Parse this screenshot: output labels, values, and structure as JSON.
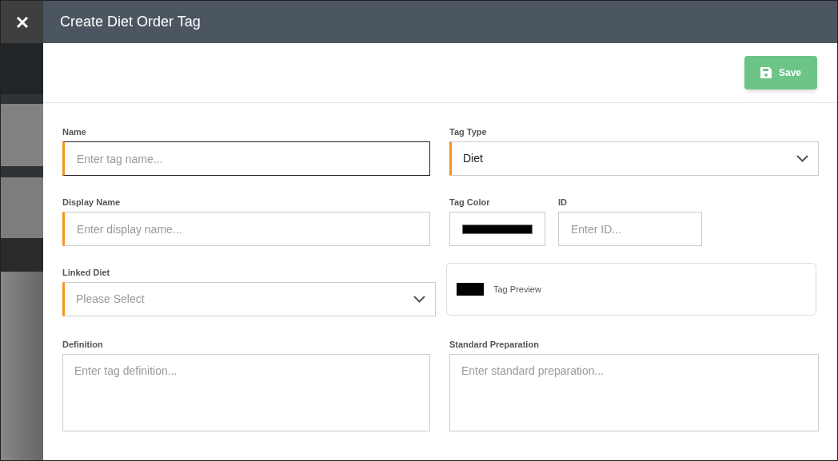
{
  "header": {
    "title": "Create Diet Order Tag"
  },
  "toolbar": {
    "save_label": "Save"
  },
  "form": {
    "name": {
      "label": "Name",
      "placeholder": "Enter tag name...",
      "required": true,
      "focused": true
    },
    "tag_type": {
      "label": "Tag Type",
      "value": "Diet",
      "required": true
    },
    "display_name": {
      "label": "Display Name",
      "placeholder": "Enter display name...",
      "required": true,
      "focused": false
    },
    "tag_color": {
      "label": "Tag Color",
      "color": "#000000"
    },
    "id": {
      "label": "ID",
      "placeholder": "Enter ID...",
      "required": false,
      "focused": false
    },
    "linked_diet": {
      "label": "Linked Diet",
      "placeholder": "Please Select",
      "required": true
    },
    "preview": {
      "label": "Tag Preview",
      "color": "#000000"
    },
    "definition": {
      "label": "Definition",
      "placeholder": "Enter tag definition..."
    },
    "standard_preparation": {
      "label": "Standard Preparation",
      "placeholder": "Enter standard preparation..."
    }
  }
}
